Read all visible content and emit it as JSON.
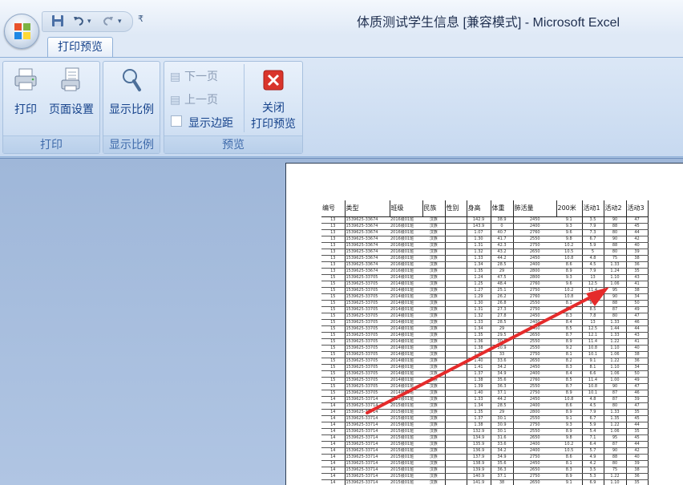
{
  "window": {
    "title": "体质测试学生信息  [兼容模式] - Microsoft Excel"
  },
  "qat": {
    "dropdown_glyph": "▾",
    "more_glyph": "₹"
  },
  "tabs": [
    {
      "label": "打印预览",
      "active": true
    }
  ],
  "ribbon": {
    "groups": {
      "print": {
        "label": "打印",
        "buttons": {
          "print": "打印",
          "page_setup": "页面设置"
        }
      },
      "zoom": {
        "label": "显示比例",
        "buttons": {
          "zoom": "显示比例"
        }
      },
      "preview": {
        "label": "预览",
        "buttons": {
          "next_page": "下一页",
          "prev_page": "上一页",
          "show_margins": "显示边距",
          "close_line1": "关闭",
          "close_line2": "打印预览"
        }
      }
    }
  },
  "sheet": {
    "headers": [
      "编号",
      "类型",
      "班级",
      "民族",
      "性别",
      "身高",
      "体重",
      "肺活量",
      "200米",
      "活动1",
      "活动2",
      "活动3"
    ],
    "rows": [
      [
        "13",
        "1539625-33674",
        "2016级01班",
        "汉族",
        "",
        "142.9",
        "38.9",
        "2450",
        "9.1",
        "3.5",
        "90",
        "47"
      ],
      [
        "13",
        "1539625-33674",
        "2016级01班",
        "汉族",
        "",
        "143.9",
        "0",
        "2400",
        "9.3",
        "7.9",
        "88",
        "45"
      ],
      [
        "13",
        "1539625-33674",
        "2016级01班",
        "汉族",
        "",
        "1.07",
        "40.7",
        "2760",
        "9.6",
        "7.3",
        "80",
        "44"
      ],
      [
        "13",
        "1539625-33674",
        "2016级01班",
        "汉族",
        "",
        "1.30",
        "41.7",
        "2550",
        "9.8",
        "6.7",
        "90",
        "42"
      ],
      [
        "13",
        "1539625-33674",
        "2016级01班",
        "汉族",
        "",
        "1.31",
        "42.3",
        "2750",
        "10.2",
        "5.9",
        "88",
        "40"
      ],
      [
        "13",
        "1539625-33674",
        "2016级01班",
        "汉族",
        "",
        "1.32",
        "43.2",
        "2650",
        "10.5",
        "5",
        "80",
        "39"
      ],
      [
        "13",
        "1539625-33674",
        "2016级01班",
        "汉族",
        "",
        "1.33",
        "44.2",
        "2450",
        "10.8",
        "4.8",
        "75",
        "38"
      ],
      [
        "13",
        "1539625-33674",
        "2016级01班",
        "汉族",
        "",
        "1.34",
        "28.5",
        "2400",
        "8.6",
        "4.5",
        "1.33",
        "36"
      ],
      [
        "13",
        "1539625-33674",
        "2016级01班",
        "汉族",
        "",
        "1.35",
        "29",
        "2800",
        "8.9",
        "7.9",
        "1.24",
        "35"
      ],
      [
        "15",
        "1539625-33705",
        "2014级01班",
        "汉族",
        "",
        "1.24",
        "47.5",
        "2800",
        "9.3",
        "13",
        "1.10",
        "43"
      ],
      [
        "15",
        "1539625-33705",
        "2014级01班",
        "汉族",
        "",
        "1.25",
        "48.4",
        "2760",
        "9.6",
        "12.5",
        "1.06",
        "41"
      ],
      [
        "15",
        "1539625-33705",
        "2014级01班",
        "汉族",
        "",
        "1.27",
        "25.1",
        "2750",
        "10.2",
        "11.4",
        "95",
        "38"
      ],
      [
        "15",
        "1539625-33705",
        "2014级01班",
        "汉族",
        "",
        "1.29",
        "26.2",
        "2760",
        "10.8",
        "10.1",
        "90",
        "34"
      ],
      [
        "15",
        "1539625-33705",
        "2014级01班",
        "汉族",
        "",
        "1.30",
        "26.8",
        "2550",
        "8.1",
        "9.7",
        "88",
        "50"
      ],
      [
        "15",
        "1539625-33705",
        "2014级01班",
        "汉族",
        "",
        "1.31",
        "27.3",
        "2750",
        "8.2",
        "8.5",
        "87",
        "49"
      ],
      [
        "15",
        "1539625-33705",
        "2014级01班",
        "汉族",
        "",
        "1.32",
        "27.8",
        "2450",
        "8.3",
        "7.8",
        "80",
        "47"
      ],
      [
        "15",
        "1539625-33705",
        "2014级01班",
        "汉族",
        "",
        "1.33",
        "28.5",
        "2400",
        "8.4",
        "13",
        "1.33",
        "46"
      ],
      [
        "15",
        "1539625-33705",
        "2014级01班",
        "汉族",
        "",
        "1.34",
        "29",
        "2400",
        "8.5",
        "12.5",
        "1.44",
        "44"
      ],
      [
        "15",
        "1539625-33705",
        "2014级01班",
        "汉族",
        "",
        "1.35",
        "29.5",
        "2650",
        "8.7",
        "12.1",
        "1.33",
        "43"
      ],
      [
        "15",
        "1539625-33705",
        "2014级01班",
        "汉族",
        "",
        "1.36",
        "30.1",
        "2550",
        "8.9",
        "11.4",
        "1.22",
        "41"
      ],
      [
        "15",
        "1539625-33705",
        "2014级01班",
        "汉族",
        "",
        "1.38",
        "30.9",
        "2550",
        "9.2",
        "10.8",
        "1.10",
        "40"
      ],
      [
        "15",
        "1539625-33705",
        "2014级01班",
        "汉族",
        "",
        "1.39",
        "33",
        "2750",
        "8.1",
        "10.1",
        "1.06",
        "38"
      ],
      [
        "15",
        "1539625-33705",
        "2014级01班",
        "汉族",
        "",
        "1.40",
        "33.6",
        "2650",
        "8.2",
        "9.1",
        "1.22",
        "36"
      ],
      [
        "15",
        "1539625-33705",
        "2014级01班",
        "汉族",
        "",
        "1.41",
        "34.2",
        "2450",
        "8.3",
        "8.1",
        "1.10",
        "34"
      ],
      [
        "15",
        "1539625-33705",
        "2014级01班",
        "汉族",
        "",
        "1.37",
        "34.9",
        "2400",
        "8.4",
        "6.6",
        "1.06",
        "50"
      ],
      [
        "15",
        "1539625-33705",
        "2014级01班",
        "汉族",
        "",
        "1.38",
        "35.6",
        "2760",
        "8.5",
        "11.4",
        "1.00",
        "49"
      ],
      [
        "15",
        "1539625-33705",
        "2014级01班",
        "汉族",
        "",
        "1.39",
        "36.3",
        "2550",
        "8.7",
        "10.8",
        "90",
        "47"
      ],
      [
        "15",
        "1539625-33705",
        "2014级01班",
        "汉族",
        "",
        "1.40",
        "37.1",
        "2750",
        "8.9",
        "10.1",
        "87",
        "46"
      ],
      [
        "14",
        "1539625-33714",
        "2015级01班",
        "汉族",
        "",
        "1.33",
        "44.2",
        "2450",
        "10.8",
        "4.8",
        "87",
        "39"
      ],
      [
        "14",
        "1539625-33714",
        "2015级01班",
        "汉族",
        "",
        "1.34",
        "28.5",
        "2400",
        "8.6",
        "4.5",
        "80",
        "47"
      ],
      [
        "14",
        "1539625-33714",
        "2015级01班",
        "汉族",
        "",
        "1.35",
        "29",
        "2800",
        "8.9",
        "7.9",
        "1.33",
        "35"
      ],
      [
        "14",
        "1539625-33714",
        "2015级01班",
        "汉族",
        "",
        "1.37",
        "30.1",
        "2550",
        "9.1",
        "6.7",
        "1.35",
        "45"
      ],
      [
        "14",
        "1539625-33714",
        "2015级01班",
        "汉族",
        "",
        "1.38",
        "30.9",
        "2750",
        "9.3",
        "5.9",
        "1.22",
        "44"
      ],
      [
        "14",
        "1539625-33714",
        "2015级01班",
        "汉族",
        "",
        "132.9",
        "30.1",
        "2550",
        "8.9",
        "5.4",
        "1.06",
        "35"
      ],
      [
        "14",
        "1539625-33714",
        "2015级01班",
        "汉族",
        "",
        "134.9",
        "31.6",
        "2650",
        "9.8",
        "7.1",
        "95",
        "45"
      ],
      [
        "14",
        "1539625-33714",
        "2015级01班",
        "汉族",
        "",
        "135.9",
        "33.6",
        "2400",
        "10.2",
        "6.4",
        "87",
        "44"
      ],
      [
        "14",
        "1539625-33714",
        "2015级01班",
        "汉族",
        "",
        "136.9",
        "34.2",
        "2400",
        "10.5",
        "5.7",
        "90",
        "42"
      ],
      [
        "14",
        "1539625-33714",
        "2015级01班",
        "汉族",
        "",
        "137.9",
        "34.9",
        "2750",
        "8.6",
        "4.9",
        "88",
        "40"
      ],
      [
        "14",
        "1539625-33714",
        "2015级01班",
        "汉族",
        "",
        "138.9",
        "35.6",
        "2450",
        "8.1",
        "4.2",
        "80",
        "39"
      ],
      [
        "14",
        "1539625-33714",
        "2015级01班",
        "汉族",
        "",
        "139.9",
        "36.3",
        "2650",
        "8.3",
        "3.5",
        "75",
        "38"
      ],
      [
        "14",
        "1539625-33714",
        "2015级01班",
        "汉族",
        "",
        "140.9",
        "37.1",
        "2750",
        "8.9",
        "5.3",
        "1.22",
        "36"
      ],
      [
        "14",
        "1539625-33714",
        "2015级01班",
        "汉族",
        "",
        "141.9",
        "38",
        "2650",
        "9.1",
        "6.9",
        "1.10",
        "35"
      ],
      [
        "14",
        "1539625-33714",
        "2015级01班",
        "汉族",
        "",
        "142.9",
        "38.9",
        "2450",
        "9.1",
        "7.1",
        "1.22",
        "36"
      ],
      [
        "14",
        "1539625-33714",
        "2015级01班",
        "汉族",
        "",
        "143.9",
        "39.8",
        "2400",
        "9.3",
        "7.9",
        "1.33",
        "35"
      ]
    ]
  },
  "annotation": {
    "arrow_color": "#e52b2b"
  }
}
